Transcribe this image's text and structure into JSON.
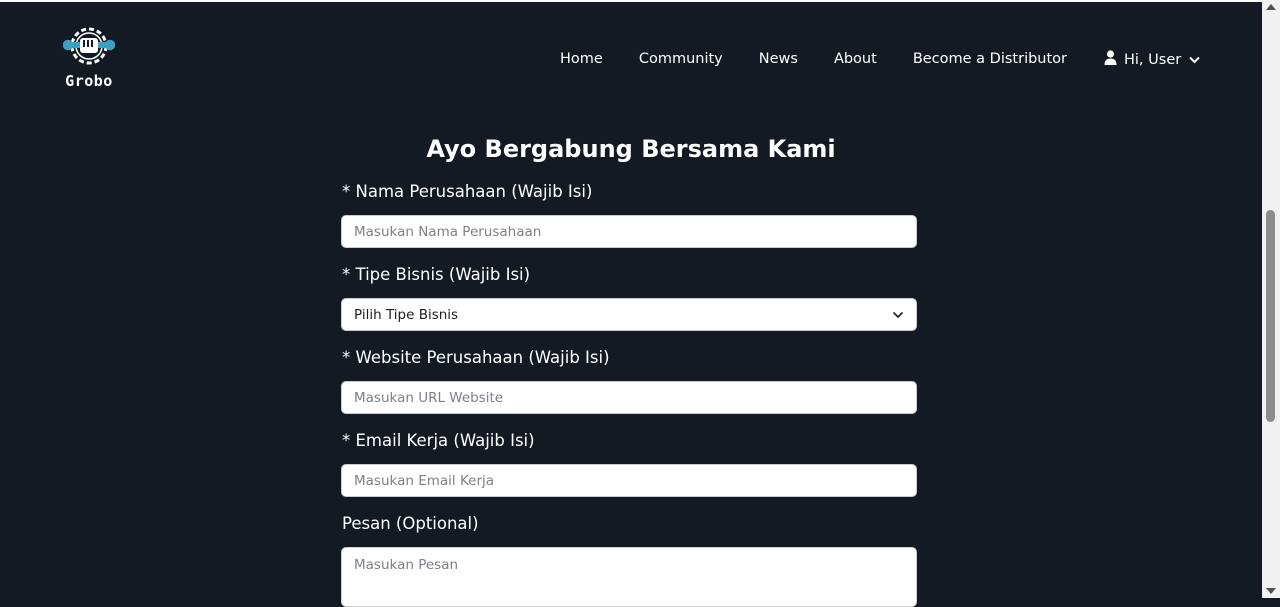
{
  "brand": {
    "name": "Grobo"
  },
  "nav": {
    "items": [
      "Home",
      "Community",
      "News",
      "About",
      "Become a Distributor"
    ],
    "user_label": "Hi, User"
  },
  "form": {
    "title": "Ayo Bergabung Bersama Kami",
    "fields": [
      {
        "label": "* Nama Perusahaan (Wajib Isi)",
        "placeholder": "Masukan Nama Perusahaan"
      },
      {
        "label": "* Tipe Bisnis (Wajib Isi)",
        "value": "Pilih Tipe Bisnis"
      },
      {
        "label": "* Website Perusahaan (Wajib Isi)",
        "placeholder": "Masukan URL Website"
      },
      {
        "label": "* Email Kerja (Wajib Isi)",
        "placeholder": "Masukan Email Kerja"
      },
      {
        "label": "Pesan (Optional)",
        "placeholder": "Masukan Pesan"
      }
    ]
  },
  "icons": {
    "logo": "gear-wrench-fist-icon",
    "user": "user-icon",
    "user_menu": "chevron-down-icon",
    "select": "chevron-down-icon"
  },
  "colors": {
    "background": "#131a24",
    "text": "#ffffff",
    "input_bg": "#ffffff",
    "logo_accent": "#3d9fc4"
  }
}
